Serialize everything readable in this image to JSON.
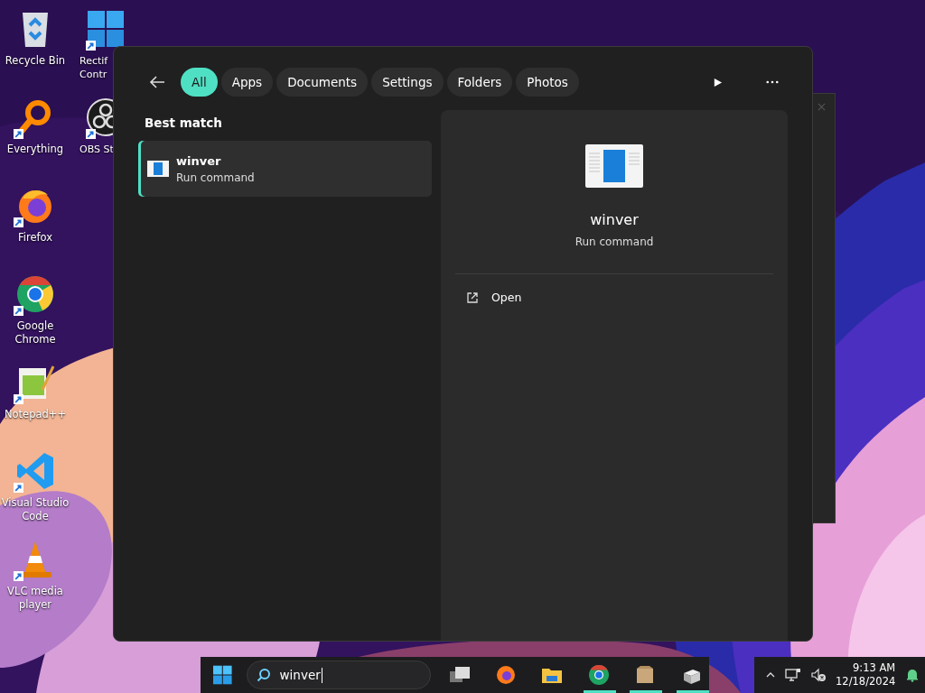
{
  "desktop": {
    "icons": [
      {
        "kind": "recycle",
        "label": "Recycle Bin",
        "shortcut": false
      },
      {
        "kind": "everything",
        "label": "Everything",
        "shortcut": true
      },
      {
        "kind": "firefox",
        "label": "Firefox",
        "shortcut": true
      },
      {
        "kind": "chrome",
        "label": "Google\nChrome",
        "shortcut": true
      },
      {
        "kind": "notepad",
        "label": "Notepad++",
        "shortcut": true
      },
      {
        "kind": "vscode",
        "label": "Visual Studio\nCode",
        "shortcut": true
      },
      {
        "kind": "vlc",
        "label": "VLC media\nplayer",
        "shortcut": true
      },
      {
        "kind": "rectify",
        "label": "Rectif\nContr",
        "shortcut": true
      },
      {
        "kind": "obs",
        "label": "OBS St",
        "shortcut": true
      }
    ]
  },
  "search_panel": {
    "filters": [
      {
        "label": "All",
        "selected": true
      },
      {
        "label": "Apps",
        "selected": false
      },
      {
        "label": "Documents",
        "selected": false
      },
      {
        "label": "Settings",
        "selected": false
      },
      {
        "label": "Folders",
        "selected": false
      },
      {
        "label": "Photos",
        "selected": false
      }
    ],
    "section_title": "Best match",
    "results": [
      {
        "name": "winver",
        "type": "Run command",
        "selected": true
      }
    ],
    "detail": {
      "name": "winver",
      "type": "Run command",
      "actions": [
        "Open"
      ]
    }
  },
  "taskbar": {
    "search": {
      "value": "winver"
    },
    "apps": [
      {
        "kind": "taskview",
        "running": false
      },
      {
        "kind": "firefox",
        "running": false
      },
      {
        "kind": "explorer",
        "running": false
      },
      {
        "kind": "chrome",
        "running": true
      },
      {
        "kind": "box",
        "running": true
      },
      {
        "kind": "drive",
        "running": true
      }
    ],
    "clock": {
      "time": "9:13 AM",
      "date": "12/18/2024"
    }
  }
}
